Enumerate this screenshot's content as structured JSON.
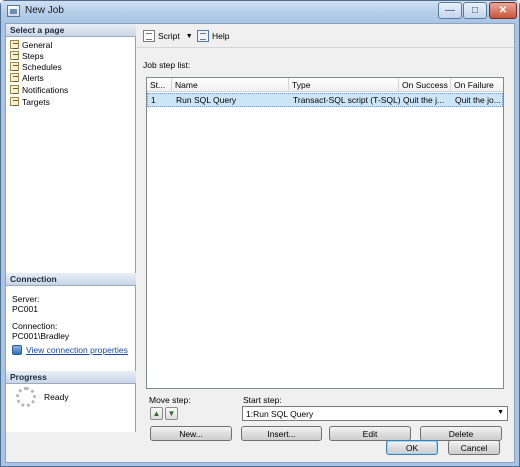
{
  "window": {
    "title": "New Job"
  },
  "left": {
    "select_page_header": "Select a page",
    "pages": [
      "General",
      "Steps",
      "Schedules",
      "Alerts",
      "Notifications",
      "Targets"
    ],
    "connection_header": "Connection",
    "server_label": "Server:",
    "server_value": "PC001",
    "connection_label": "Connection:",
    "connection_value": "PC001\\Bradley",
    "view_connection_link": "View connection properties",
    "progress_header": "Progress",
    "progress_status": "Ready"
  },
  "toolbar": {
    "script_label": "Script",
    "help_label": "Help"
  },
  "main": {
    "list_label": "Job step list:",
    "columns": [
      "St...",
      "Name",
      "Type",
      "On Success",
      "On Failure"
    ],
    "rows": [
      [
        "1",
        "Run SQL Query",
        "Transact-SQL script (T-SQL)",
        "Quit the j...",
        "Quit the jo..."
      ]
    ],
    "move_step_label": "Move step:",
    "start_step_label": "Start step:",
    "start_step_value": "1:Run SQL Query",
    "buttons": {
      "new": "New...",
      "insert": "Insert...",
      "edit": "Edit",
      "delete": "Delete"
    }
  },
  "footer": {
    "ok": "OK",
    "cancel": "Cancel"
  },
  "colors": {
    "title_bar": "#a9c4e4",
    "selection": "#cde6f7",
    "link": "#1a4aa8"
  }
}
